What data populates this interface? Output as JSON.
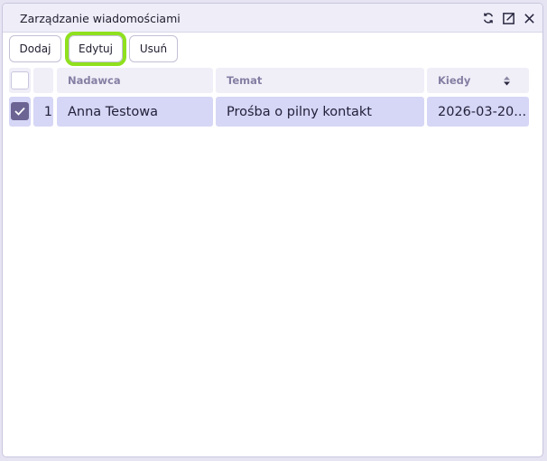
{
  "window": {
    "title": "Zarządzanie wiadomościami",
    "icons": [
      "refresh-icon",
      "open-external-icon",
      "close-icon"
    ]
  },
  "toolbar": {
    "add_label": "Dodaj",
    "edit_label": "Edytuj",
    "delete_label": "Usuń",
    "focused": "edit"
  },
  "table": {
    "columns": [
      "Nadawca",
      "Temat",
      "Kiedy"
    ],
    "sorted_column": "Kiedy",
    "rows": [
      {
        "checked": true,
        "index": "1",
        "sender": "Anna Testowa",
        "subject": "Prośba o pilny kontakt",
        "when": "2026-03-20..."
      }
    ]
  },
  "colors": {
    "accent_focus": "#8fe01d",
    "selected_row": "#d6d6f6",
    "checkbox_checked": "#6c6493",
    "header_text": "#857fa3"
  }
}
